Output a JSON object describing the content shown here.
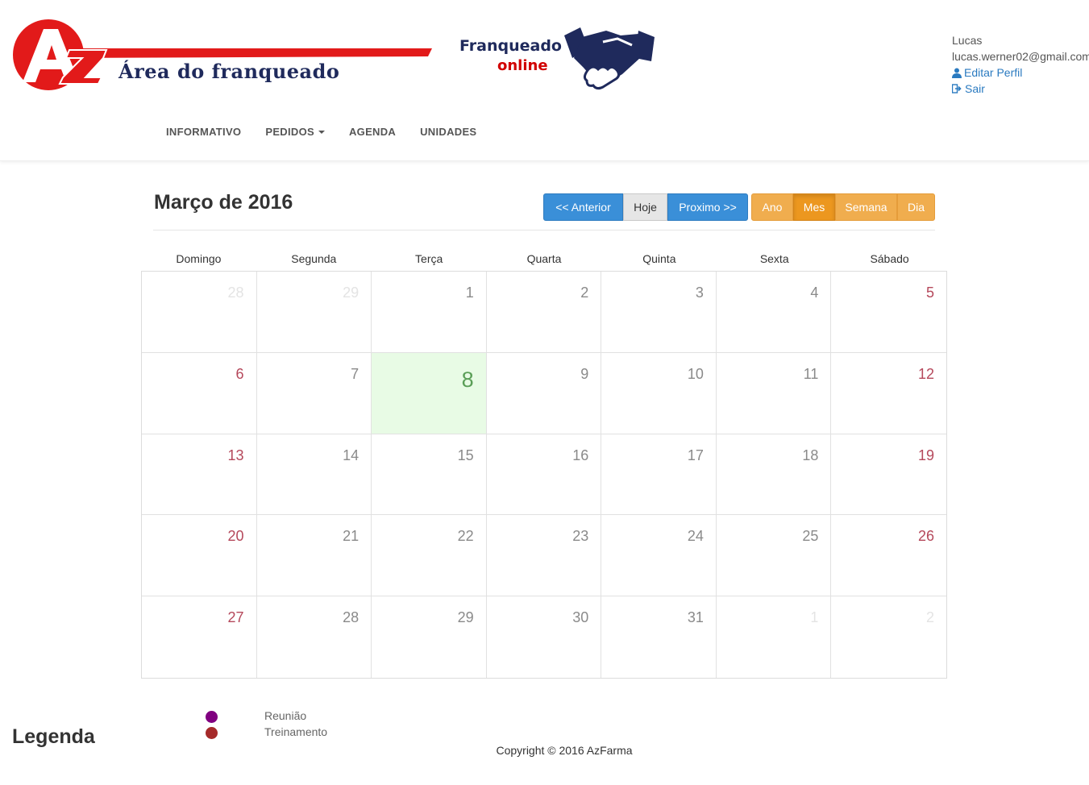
{
  "brand": {
    "logo_text": "Área do franqueado",
    "logo_letters": "AZ",
    "partner_line1": "Franqueado",
    "partner_line2": "online"
  },
  "user": {
    "name": "Lucas",
    "email": "lucas.werner02@gmail.com",
    "edit_profile": "Editar Perfil",
    "logout": "Sair"
  },
  "nav": {
    "items": [
      {
        "label": "INFORMATIVO"
      },
      {
        "label": "PEDIDOS"
      },
      {
        "label": "AGENDA"
      },
      {
        "label": "UNIDADES"
      }
    ]
  },
  "calendar": {
    "title": "Março de 2016",
    "nav_buttons": {
      "prev": "<< Anterior",
      "today": "Hoje",
      "next": "Proximo >>"
    },
    "view_buttons": {
      "year": "Ano",
      "month": "Mes",
      "week": "Semana",
      "day": "Dia",
      "active": "Mes"
    },
    "weekdays": [
      "Domingo",
      "Segunda",
      "Terça",
      "Quarta",
      "Quinta",
      "Sexta",
      "Sábado"
    ],
    "today_date": "8",
    "weeks": [
      [
        "28",
        "29",
        "1",
        "2",
        "3",
        "4",
        "5"
      ],
      [
        "6",
        "7",
        "8",
        "9",
        "10",
        "11",
        "12"
      ],
      [
        "13",
        "14",
        "15",
        "16",
        "17",
        "18",
        "19"
      ],
      [
        "20",
        "21",
        "22",
        "23",
        "24",
        "25",
        "26"
      ],
      [
        "27",
        "28",
        "29",
        "30",
        "31",
        "1",
        "2"
      ]
    ],
    "colors": {
      "today_bg": "#e8fbe5",
      "weekend_text": "#b5485b",
      "primary": "#3a8fd8",
      "warning": "#f0ad4e"
    }
  },
  "legend": {
    "title": "Legenda",
    "items": [
      {
        "label": "Reunião",
        "color": "#800080"
      },
      {
        "label": "Treinamento",
        "color": "#a52a2a"
      }
    ]
  },
  "footer": {
    "text": "Copyright © 2016 AzFarma"
  }
}
